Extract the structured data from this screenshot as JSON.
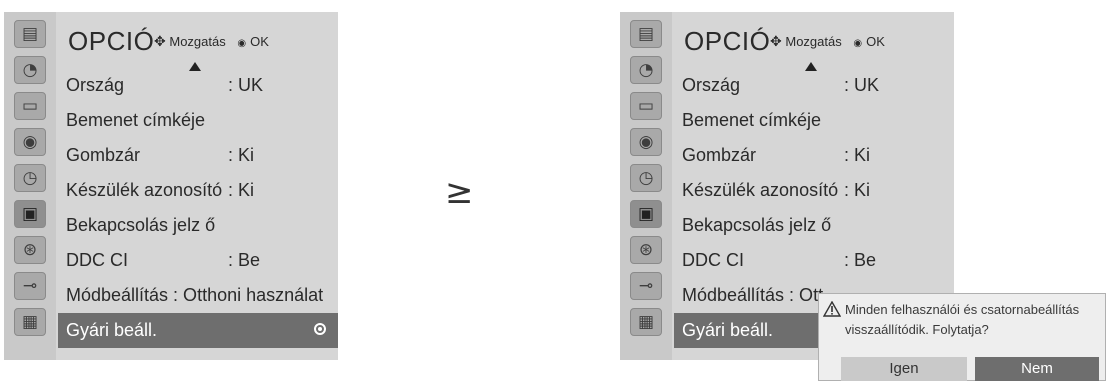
{
  "separator": "≥",
  "menu": {
    "title": "OPCIÓ",
    "nav_hint": "Mozgatás",
    "ok_hint": "OK",
    "items": [
      {
        "label": "Ország",
        "value": ": UK"
      },
      {
        "label": "Bemenet címkéje",
        "value": ""
      },
      {
        "label": "Gombzár",
        "value": ": Ki"
      },
      {
        "label": "Készülék azonosító",
        "value": ": Ki"
      },
      {
        "label": "Bekapcsolás jelz ő",
        "value": ""
      },
      {
        "label": "DDC CI",
        "value": ": Be"
      },
      {
        "label": "Módbeállítás : Otthoni használat",
        "value": ""
      },
      {
        "label": "Gyári beáll.",
        "value": ""
      }
    ],
    "right_items": [
      {
        "label": "Ország",
        "value": ": UK"
      },
      {
        "label": "Bemenet címkéje",
        "value": ""
      },
      {
        "label": "Gombzár",
        "value": ": Ki"
      },
      {
        "label": "Készülék azonosító",
        "value": ": Ki"
      },
      {
        "label": "Bekapcsolás jelz ő",
        "value": ""
      },
      {
        "label": "DDC CI",
        "value": ": Be"
      },
      {
        "label": "Módbeállítás : Ott",
        "value": ""
      },
      {
        "label": "Gyári beáll.",
        "value": ""
      }
    ]
  },
  "sidebar_icons": [
    "option-icon",
    "satellite-icon",
    "monitor-icon",
    "speaker-icon",
    "clock-icon",
    "option-active-icon",
    "lock-icon",
    "input-icon",
    "photo-icon"
  ],
  "dialog": {
    "message": "Minden felhasználói és csatornabeállítás visszaállítódik. Folytatja?",
    "yes": "Igen",
    "no": "Nem"
  },
  "colors": {
    "panel": "#d6d6d6",
    "selected": "#6e6e6e",
    "dialog": "#eeeeee"
  }
}
